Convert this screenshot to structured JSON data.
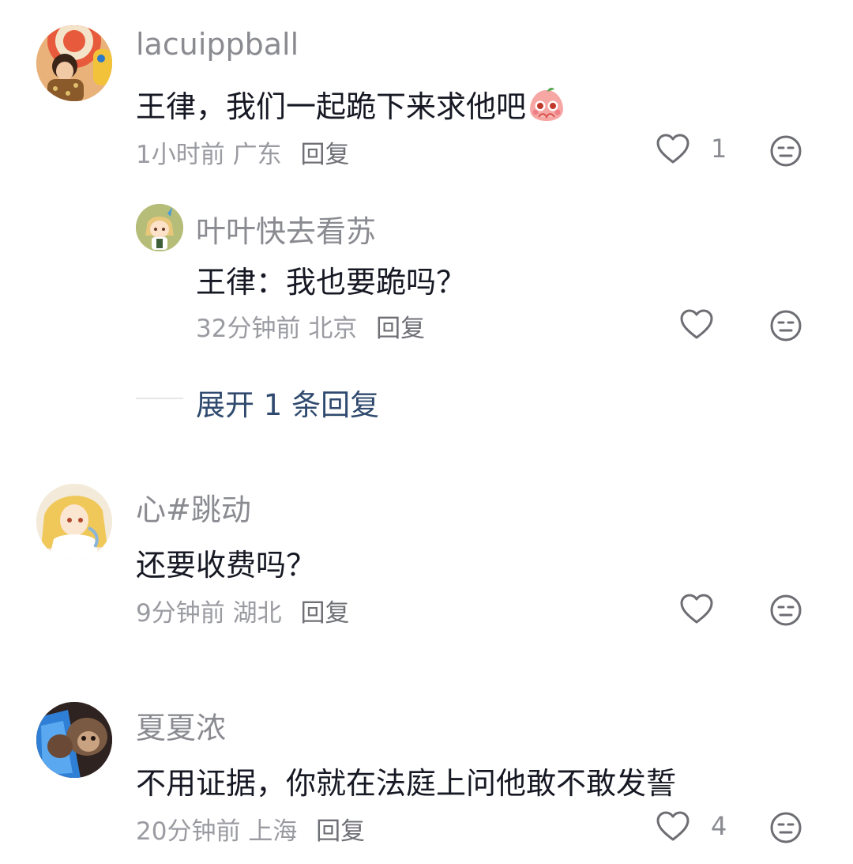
{
  "comments": [
    {
      "username": "lacuippball",
      "text": "王律，我们一起跪下来求他吧",
      "time": "1小时前",
      "location": "广东",
      "reply_label": "回复",
      "likes": "1",
      "replies": [
        {
          "username": "叶叶快去看苏",
          "text": "王律：我也要跪吗？",
          "time": "32分钟前",
          "location": "北京",
          "reply_label": "回复",
          "likes": ""
        }
      ],
      "expand_label": "展开 1 条回复"
    },
    {
      "username": "心#跳动",
      "text": "还要收费吗？",
      "time": "9分钟前",
      "location": "湖北",
      "reply_label": "回复",
      "likes": ""
    },
    {
      "username": "夏夏浓",
      "text": "不用证据，你就在法庭上问他敢不敢发誓",
      "time": "20分钟前",
      "location": "上海",
      "reply_label": "回复",
      "likes": "4"
    }
  ],
  "icons": {
    "like": "heart-outline-icon",
    "dislike": "meh-face-icon",
    "emoji": "blushing-peach-emoji"
  },
  "colors": {
    "text": "#161823",
    "secondary": "#8a8b91",
    "link": "#2f4a6e",
    "icon": "#6d6e73"
  }
}
